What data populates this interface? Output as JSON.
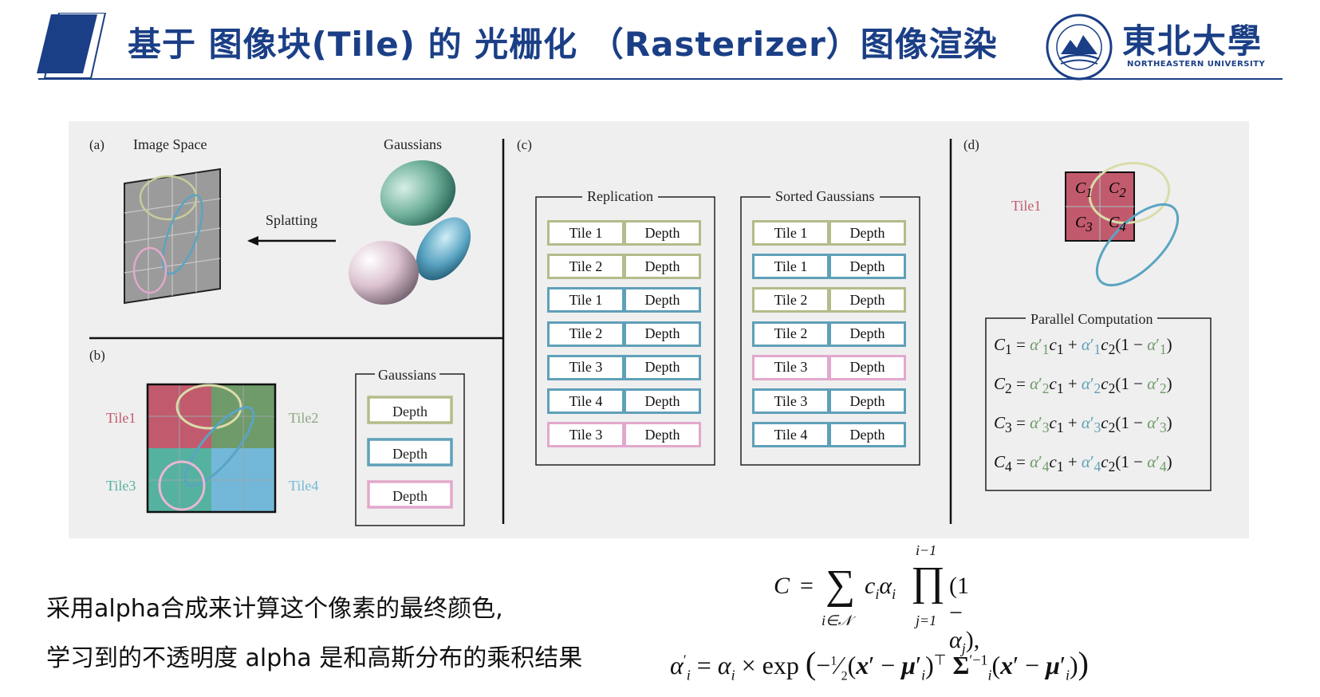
{
  "header": {
    "title": "基于 图像块(Tile) 的 光栅化 （Rasterizer）图像渲染",
    "university_cn": "東北大學",
    "university_en": "NORTHEASTERN UNIVERSITY"
  },
  "figure": {
    "panel_a": {
      "label": "(a)",
      "image_space": "Image Space",
      "gaussians": "Gaussians",
      "splatting": "Splatting"
    },
    "panel_b": {
      "label": "(b)",
      "tiles": [
        "Tile1",
        "Tile2",
        "Tile3",
        "Tile4"
      ],
      "legend_title": "Gaussians",
      "legend_items": [
        "Depth",
        "Depth",
        "Depth"
      ]
    },
    "panel_c": {
      "label": "(c)",
      "replication": {
        "title": "Replication",
        "rows": [
          {
            "tile": "Tile 1",
            "depth": "Depth",
            "color": "#b5bb8a"
          },
          {
            "tile": "Tile 2",
            "depth": "Depth",
            "color": "#b5bb8a"
          },
          {
            "tile": "Tile 1",
            "depth": "Depth",
            "color": "#5fa0b8"
          },
          {
            "tile": "Tile 2",
            "depth": "Depth",
            "color": "#5fa0b8"
          },
          {
            "tile": "Tile 3",
            "depth": "Depth",
            "color": "#5fa0b8"
          },
          {
            "tile": "Tile 4",
            "depth": "Depth",
            "color": "#5fa0b8"
          },
          {
            "tile": "Tile 3",
            "depth": "Depth",
            "color": "#e2a8cc"
          }
        ]
      },
      "sorted": {
        "title": "Sorted Gaussians",
        "rows": [
          {
            "tile": "Tile 1",
            "depth": "Depth",
            "color": "#b5bb8a"
          },
          {
            "tile": "Tile 1",
            "depth": "Depth",
            "color": "#5fa0b8"
          },
          {
            "tile": "Tile 2",
            "depth": "Depth",
            "color": "#b5bb8a"
          },
          {
            "tile": "Tile 2",
            "depth": "Depth",
            "color": "#5fa0b8"
          },
          {
            "tile": "Tile 3",
            "depth": "Depth",
            "color": "#e2a8cc"
          },
          {
            "tile": "Tile 3",
            "depth": "Depth",
            "color": "#5fa0b8"
          },
          {
            "tile": "Tile 4",
            "depth": "Depth",
            "color": "#5fa0b8"
          }
        ]
      }
    },
    "panel_d": {
      "label": "(d)",
      "tile": "Tile1",
      "cells": [
        "C1",
        "C2",
        "C3",
        "C4"
      ],
      "parallel_title": "Parallel Computation",
      "equations": [
        "1",
        "2",
        "3",
        "4"
      ]
    }
  },
  "bottom": {
    "line1": "采用alpha合成来计算这个像素的最终颜色,",
    "line2": "学习到的不透明度 alpha 是和高斯分布的乘积结果"
  },
  "colors": {
    "brand_blue": "#1b3f86",
    "olive": "#b5bb8a",
    "blue": "#5fa0b8",
    "pink": "#e2a8cc",
    "tile1": "#c25a6e",
    "tile2": "#6f9a6a",
    "tile3": "#55b2a0",
    "tile4": "#73b8d8"
  }
}
